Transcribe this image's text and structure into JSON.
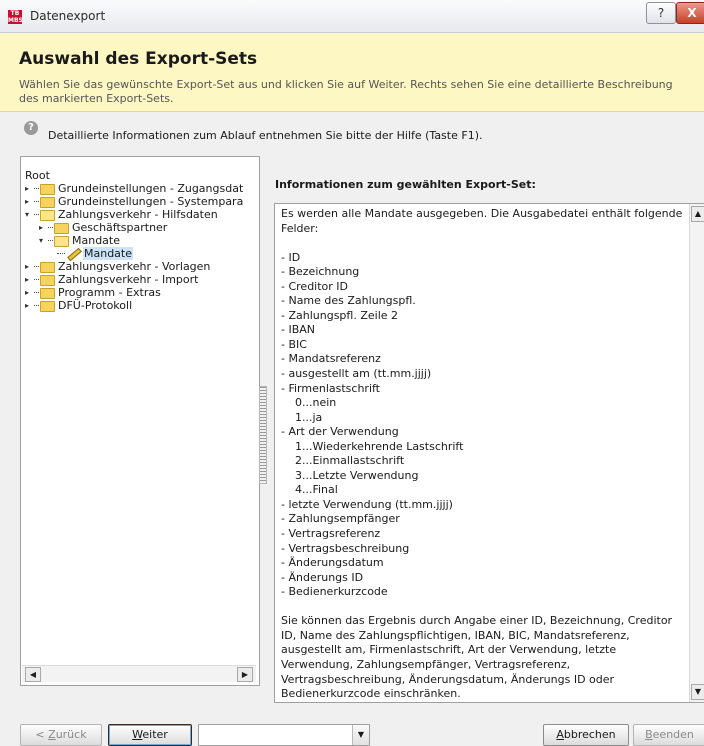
{
  "window": {
    "app_icon_text": "TB\nMBS",
    "title": "Datenexport",
    "help_button": "?",
    "close_button": "X"
  },
  "header": {
    "title": "Auswahl des Export-Sets",
    "description": "Wählen Sie das gewünschte Export-Set aus und klicken Sie auf Weiter. Rechts sehen Sie eine detaillierte Beschreibung des markierten Export-Sets."
  },
  "info": {
    "icon": "?",
    "text": "Detaillierte Informationen zum Ablauf entnehmen Sie bitte der Hilfe (Taste F1)."
  },
  "tree": {
    "root": "Root",
    "items": [
      {
        "label": "Grundeinstellungen - Zugangsdat"
      },
      {
        "label": "Grundeinstellungen - Systempara"
      },
      {
        "label": "Zahlungsverkehr - Hilfsdaten"
      },
      {
        "label": "Geschäftspartner"
      },
      {
        "label": "Mandate"
      },
      {
        "label": "Mandate"
      },
      {
        "label": "Zahlungsverkehr - Vorlagen"
      },
      {
        "label": "Zahlungsverkehr - Import"
      },
      {
        "label": "Programm - Extras"
      },
      {
        "label": "DFÜ-Protokoll"
      }
    ]
  },
  "details": {
    "heading": "Informationen zum gewählten Export-Set:",
    "intro": "Es werden alle Mandate ausgegeben. Die Ausgabedatei enthält folgende Felder:",
    "fields": [
      "- ID",
      "- Bezeichnung",
      "- Creditor ID",
      "- Name des Zahlungspfl.",
      "- Zahlungspfl. Zeile 2",
      "- IBAN",
      "- BIC",
      "- Mandatsreferenz",
      "- ausgestellt am (tt.mm.jjjj)",
      "- Firmenlastschrift",
      "    0...nein",
      "    1...ja",
      "- Art der Verwendung",
      "    1...Wiederkehrende Lastschrift",
      "    2...Einmallastschrift",
      "    3...Letzte Verwendung",
      "    4...Final",
      "- letzte Verwendung (tt.mm.jjjj)",
      "- Zahlungsempfänger",
      "- Vertragsreferenz",
      "- Vertragsbeschreibung",
      "- Änderungsdatum",
      "- Änderungs ID",
      "- Bedienerkurzcode"
    ],
    "outro": "Sie können das Ergebnis durch Angabe einer ID, Bezeichnung, Creditor ID, Name des Zahlungspflichtigen, IBAN, BIC, Mandatsreferenz, ausgestellt am, Firmenlastschrift, Art der Verwendung, letzte Verwendung, Zahlungsempfänger, Vertragsreferenz, Vertragsbeschreibung, Änderungsdatum, Änderungs ID oder Bedienerkurzcode einschränken."
  },
  "buttons": {
    "back_prefix": "< ",
    "back_u": "Z",
    "back_rest": "urück",
    "next_u": "W",
    "next_rest": "eiter",
    "cancel_u": "A",
    "cancel_rest": "bbrechen",
    "finish_u": "B",
    "finish_rest": "eenden"
  },
  "combo": {
    "value": ""
  }
}
